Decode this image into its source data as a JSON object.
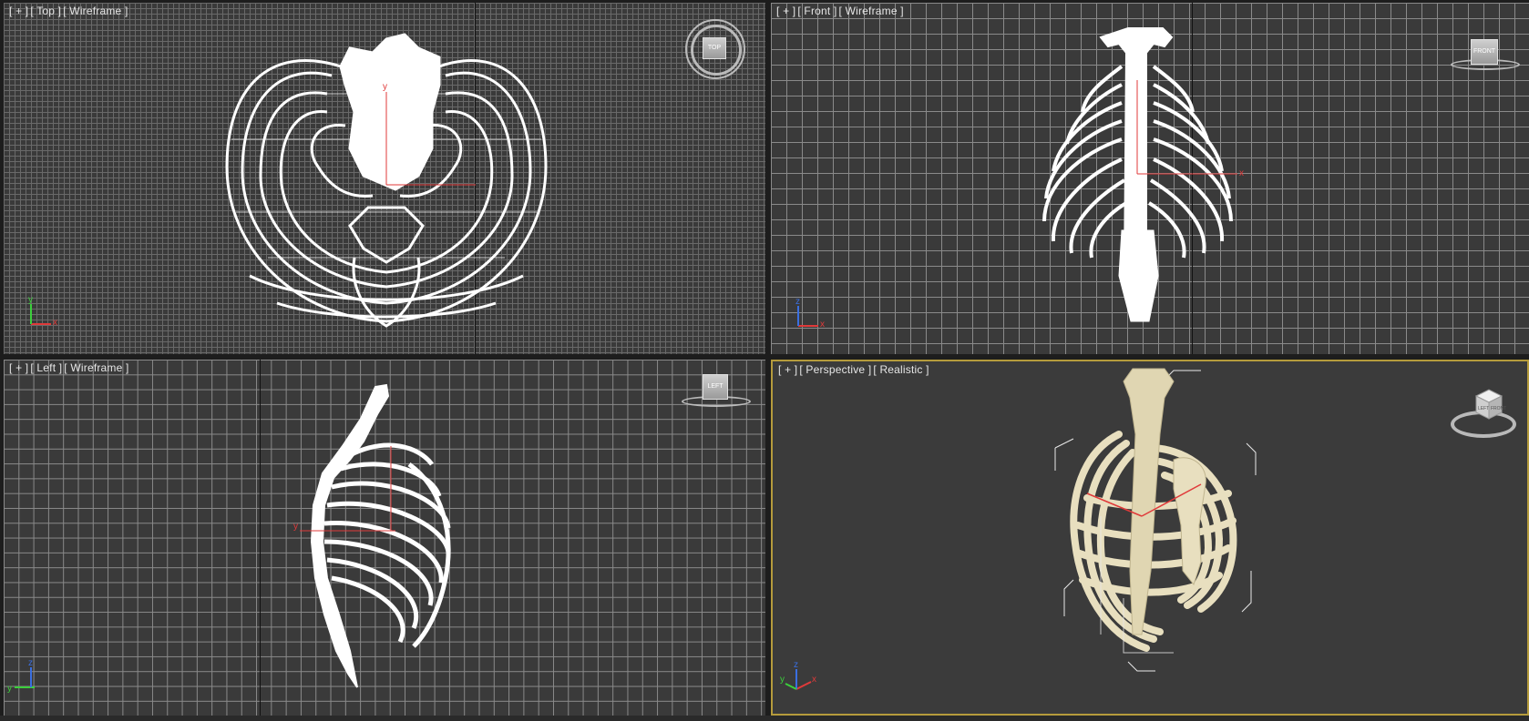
{
  "viewports": {
    "top": {
      "bracket": "[ + ]",
      "view": "[ Top ]",
      "shading": "[ Wireframe ]",
      "cube_label": "TOP"
    },
    "front": {
      "bracket": "[ + ]",
      "view": "[ Front ]",
      "shading": "[ Wireframe ]",
      "cube_label": "FRONT"
    },
    "left": {
      "bracket": "[ + ]",
      "view": "[ Left ]",
      "shading": "[ Wireframe ]",
      "cube_label": "LEFT"
    },
    "perspective": {
      "bracket": "[ + ]",
      "view": "[ Perspective ]",
      "shading": "[ Realistic ]",
      "cube_face_left": "LEFT",
      "cube_face_front": "FRONT"
    }
  },
  "axis_labels": {
    "x": "x",
    "y": "y",
    "z": "z"
  },
  "colors": {
    "viewport_bg": "#3a3a3a",
    "active_border": "#b59b3c",
    "wire": "#ffffff",
    "bone": "#e8dfbf",
    "x_axis": "#e03a3a",
    "y_axis": "#3ccf3c",
    "z_axis": "#3a6fe0"
  },
  "icons": [
    "viewcube-top-icon",
    "viewcube-front-icon",
    "viewcube-left-icon",
    "viewcube-perspective-icon",
    "axis-tripod-icon"
  ]
}
